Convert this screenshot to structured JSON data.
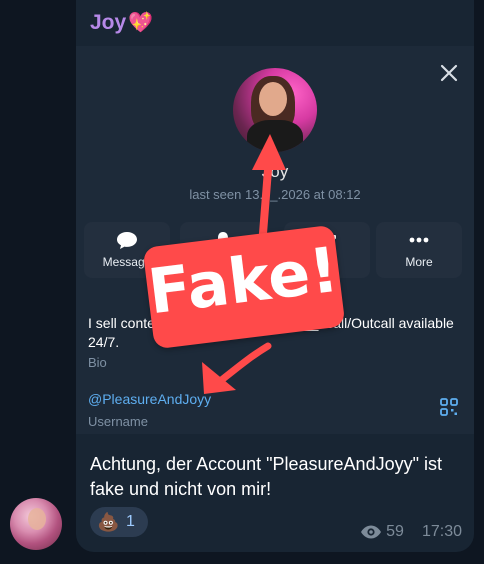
{
  "chat": {
    "sender_name": "Joy",
    "sender_emoji": "💖"
  },
  "profile": {
    "name": "Joy",
    "last_seen": "last seen 13.0_.2026 at 08:12",
    "actions": [
      {
        "label": "Message",
        "icon": "message-icon"
      },
      {
        "label": "",
        "icon": "bell-icon"
      },
      {
        "label": "",
        "icon": "gift-icon"
      },
      {
        "label": "More",
        "icon": "more-icon"
      }
    ],
    "bio_text": "I sell conte_____________________ncall/Outcall available 24/7.",
    "bio_label": "Bio",
    "username": "@PleasureAndJoyy",
    "username_label": "Username"
  },
  "message": {
    "text": "Achtung, der Account \"PleasureAndJoyy\" ist fake und nicht von mir!",
    "reaction_emoji": "💩",
    "reaction_count": "1",
    "views": "59",
    "time": "17:30"
  },
  "annotation": {
    "label": "Fake!",
    "color": "#ff4a4a"
  }
}
